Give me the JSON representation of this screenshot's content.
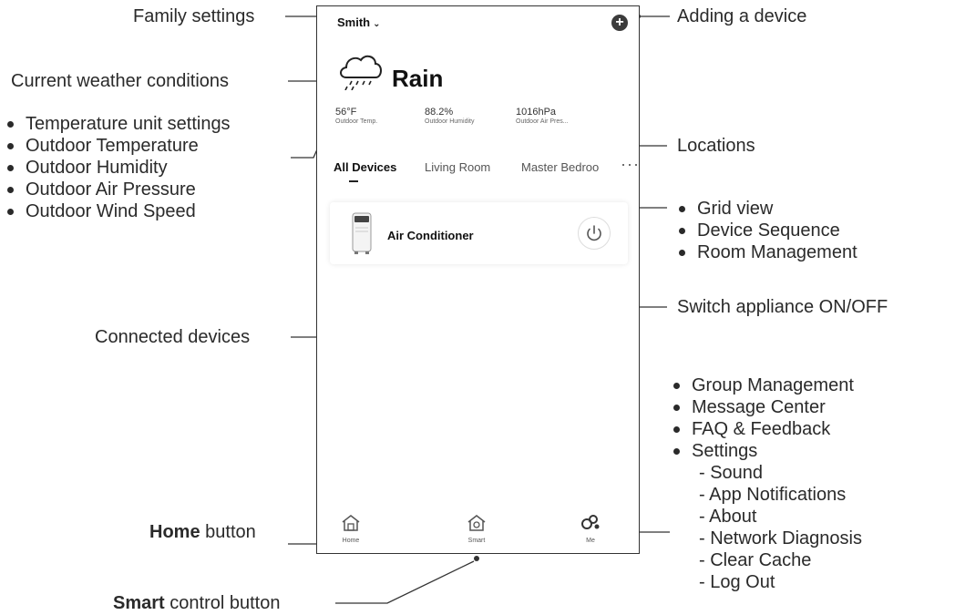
{
  "app": {
    "family_name": "Smith",
    "weather": {
      "condition": "Rain",
      "temperature": {
        "value": "56°F",
        "label": "Outdoor Temp."
      },
      "humidity": {
        "value": "88.2%",
        "label": "Outdoor Humidity"
      },
      "pressure": {
        "value": "1016hPa",
        "label": "Outdoor Air Pres..."
      }
    },
    "tabs": [
      {
        "label": "All Devices",
        "active": true
      },
      {
        "label": "Living Room",
        "active": false
      },
      {
        "label": "Master Bedroo",
        "active": false
      }
    ],
    "more_label": "···",
    "device": {
      "name": "Air Conditioner"
    },
    "nav": [
      {
        "label": "Home",
        "icon": "home-icon"
      },
      {
        "label": "Smart",
        "icon": "smart-icon"
      },
      {
        "label": "Me",
        "icon": "me-icon"
      }
    ]
  },
  "annotations": {
    "family_settings": "Family settings",
    "adding_device": "Adding a device",
    "current_weather": "Current weather conditions",
    "weather_list": [
      "Temperature unit settings",
      "Outdoor Temperature",
      "Outdoor Humidity",
      "Outdoor Air Pressure",
      "Outdoor Wind Speed"
    ],
    "locations": "Locations",
    "more_list": [
      "Grid view",
      "Device Sequence",
      "Room Management"
    ],
    "switch": "Switch appliance ON/OFF",
    "connected": "Connected devices",
    "me_list": [
      "Group Management",
      "Message Center",
      "FAQ & Feedback",
      "Settings"
    ],
    "settings_sub": [
      "- Sound",
      "- App Notifications",
      "- About",
      "- Network Diagnosis",
      "- Clear Cache",
      "- Log Out"
    ],
    "home_bold": "Home",
    "home_rest": " button",
    "smart_bold": "Smart",
    "smart_rest": " control button"
  },
  "colors": {
    "line": "#333333",
    "text": "#2a2a2a",
    "icon": "#555555"
  }
}
